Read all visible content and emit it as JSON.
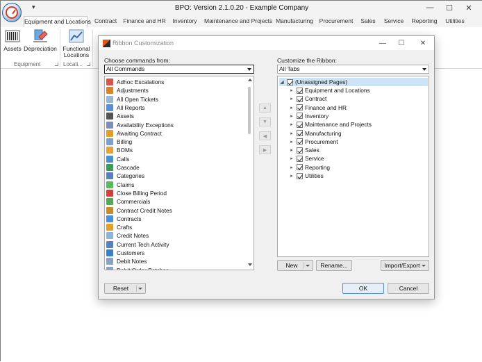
{
  "window": {
    "title": "BPO: Version 2.1.0.20 - Example Company",
    "qat_glyph": "▾"
  },
  "window_controls": {
    "minimize": "—",
    "maximize": "☐",
    "close": "✕"
  },
  "ribbon_tabs": [
    "Equipment and Locations",
    "Contract",
    "Finance and HR",
    "Inventory",
    "Maintenance and Projects",
    "Manufacturing",
    "Procurement",
    "Sales",
    "Service",
    "Reporting",
    "Utilities"
  ],
  "ribbon": {
    "buttons": [
      "Assets",
      "Depreciation"
    ],
    "functional": {
      "line1": "Functional",
      "line2": "Locations"
    },
    "groups": [
      "Equipment",
      "Locati..."
    ]
  },
  "dialog": {
    "title": "Ribbon Customization",
    "controls": {
      "minimize": "—",
      "maximize": "☐",
      "close": "✕"
    },
    "left_label": "Choose commands from:",
    "left_select": "All Commands",
    "right_label": "Customize the Ribbon:",
    "right_select": "All Tabs",
    "commands": [
      {
        "label": "Adhoc Escalations",
        "icon": "calendar-icon",
        "color": "#d9534f"
      },
      {
        "label": "Adjustments",
        "icon": "adjust-icon",
        "color": "#d9822b"
      },
      {
        "label": "All Open Tickets",
        "icon": "ticket-icon",
        "color": "#9ab6d6"
      },
      {
        "label": "All Reports",
        "icon": "report-icon",
        "color": "#5b8fd4"
      },
      {
        "label": "Assets",
        "icon": "barcode-icon",
        "color": "#555555"
      },
      {
        "label": "Availability Exceptions",
        "icon": "calendar-icon",
        "color": "#7b8fb8"
      },
      {
        "label": "Awaiting Contract",
        "icon": "search-icon",
        "color": "#e0a02a"
      },
      {
        "label": "Billing",
        "icon": "document-icon",
        "color": "#7aa1cf"
      },
      {
        "label": "BOMs",
        "icon": "folder-icon",
        "color": "#e6a33c"
      },
      {
        "label": "Calls",
        "icon": "phone-icon",
        "color": "#4f8fcf"
      },
      {
        "label": "Cascade",
        "icon": "cascade-icon",
        "color": "#3c9a5f"
      },
      {
        "label": "Categories",
        "icon": "tags-icon",
        "color": "#5a7fbf"
      },
      {
        "label": "Claims",
        "icon": "claim-icon",
        "color": "#5cb85c"
      },
      {
        "label": "Close Billing Period",
        "icon": "close-red-icon",
        "color": "#d43f3a"
      },
      {
        "label": "Commercials",
        "icon": "money-icon",
        "color": "#58a55c"
      },
      {
        "label": "Contract Credit Notes",
        "icon": "coins-icon",
        "color": "#c98a2b"
      },
      {
        "label": "Contracts",
        "icon": "contract-icon",
        "color": "#4a90d9"
      },
      {
        "label": "Crafts",
        "icon": "tools-icon",
        "color": "#e0a02a"
      },
      {
        "label": "Credit Notes",
        "icon": "note-icon",
        "color": "#8fb3d9"
      },
      {
        "label": "Current Tech Activity",
        "icon": "person-icon",
        "color": "#5a7fbf"
      },
      {
        "label": "Customers",
        "icon": "people-icon",
        "color": "#3c7fc4"
      },
      {
        "label": "Debit Notes",
        "icon": "debit-icon",
        "color": "#8aa3c4"
      },
      {
        "label": "Debit Order Batches",
        "icon": "batch-icon",
        "color": "#8aa3c4"
      }
    ],
    "move_buttons": [
      "▲",
      "▼",
      "◀",
      "▶"
    ],
    "tree": {
      "root": "(Unassigned Pages)",
      "items": [
        "Equipment and Locations",
        "Contract",
        "Finance and HR",
        "Inventory",
        "Maintenance and Projects",
        "Manufacturing",
        "Procurement",
        "Sales",
        "Service",
        "Reporting",
        "Utilities"
      ]
    },
    "buttons": {
      "new": "New",
      "rename": "Rename...",
      "import_export": "Import/Export",
      "reset": "Reset",
      "ok": "OK",
      "cancel": "Cancel"
    }
  }
}
